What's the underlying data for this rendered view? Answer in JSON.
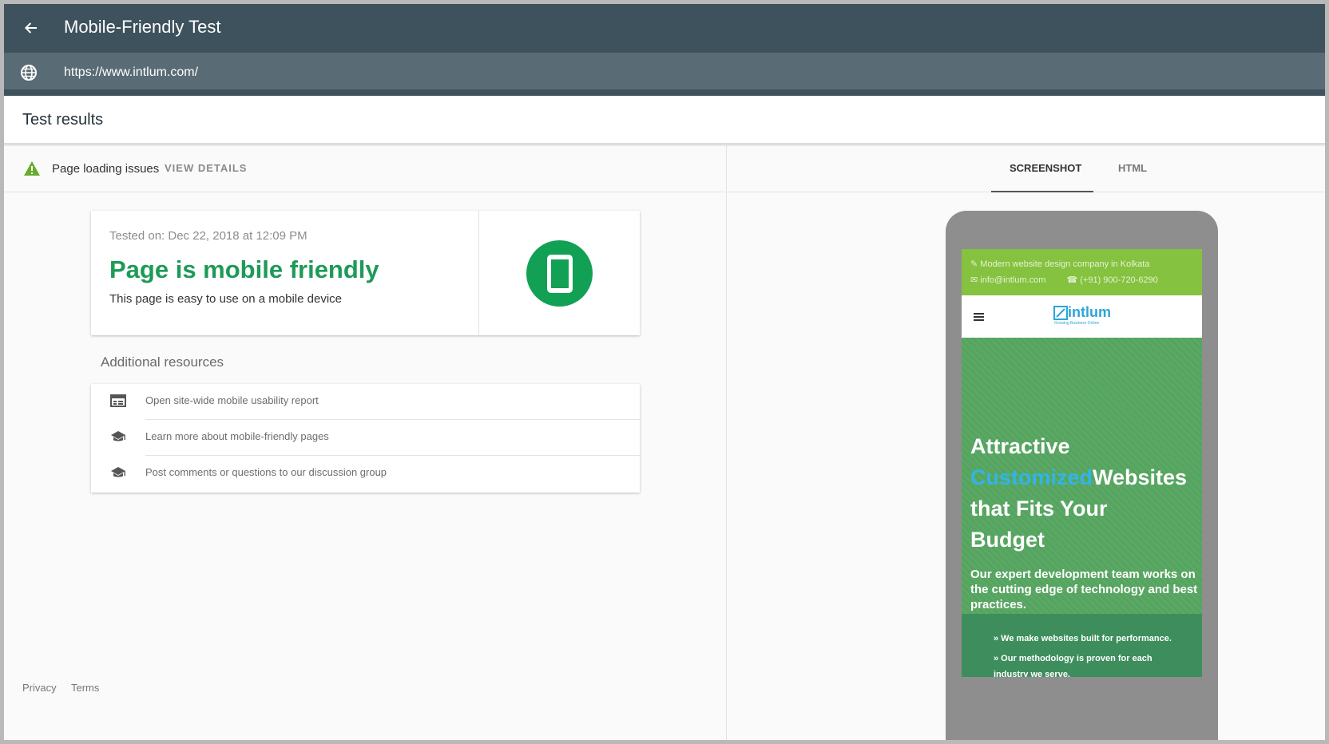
{
  "header": {
    "title": "Mobile-Friendly Test",
    "url": "https://www.intlum.com/"
  },
  "results": {
    "title": "Test results",
    "issues_label": "Page loading issues",
    "view_details": "VIEW DETAILS"
  },
  "result_card": {
    "tested_on": "Tested on: Dec 22, 2018 at 12:09 PM",
    "headline": "Page is mobile friendly",
    "subtext": "This page is easy to use on a mobile device"
  },
  "resources": {
    "title": "Additional resources",
    "items": [
      {
        "label": "Open site-wide mobile usability report",
        "icon": "report-icon"
      },
      {
        "label": "Learn more about mobile-friendly pages",
        "icon": "school-icon"
      },
      {
        "label": "Post comments or questions to our discussion group",
        "icon": "school-icon"
      }
    ]
  },
  "footer": {
    "privacy": "Privacy",
    "terms": "Terms"
  },
  "tabs": {
    "screenshot": "SCREENSHOT",
    "html": "HTML"
  },
  "preview": {
    "topbar_line1": "Modern website design company in Kolkata",
    "topbar_email": "info@intlum.com",
    "topbar_phone": "(+91) 900-720-6290",
    "logo_text": "intlum",
    "logo_tagline": "Growing Business Online",
    "hero_line1": "Attractive",
    "hero_line2_blue": "Customized",
    "hero_line2_white": "Websites",
    "hero_line3": "that Fits Your",
    "hero_line4": "Budget",
    "hero_paragraph": "Our expert development team works on the cutting edge of technology and best practices.",
    "bullet1": "» We make websites built for performance.",
    "bullet2": "» Our methodology is proven for each",
    "bullet3": "industry we serve."
  },
  "colors": {
    "header_bg": "#3e525d",
    "url_bg": "#596b75",
    "success_green": "#1e9a58",
    "warning_green": "#6aab2e",
    "preview_topbar": "#84c23f",
    "preview_hero": "#55a45f",
    "preview_blue": "#31b5e8"
  }
}
